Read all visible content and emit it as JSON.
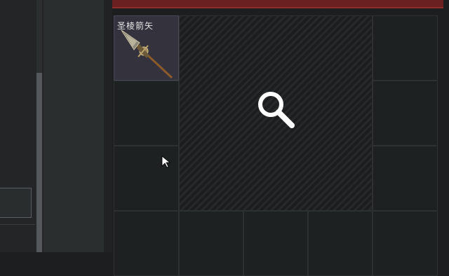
{
  "inventory": {
    "item": {
      "name": "圣棱箭矢",
      "icon": "arrow-item-icon"
    },
    "inspect_icon": "magnifier-icon"
  },
  "colors": {
    "accent_red": "#6a1f20",
    "item_slot_bg": "#34323d"
  }
}
